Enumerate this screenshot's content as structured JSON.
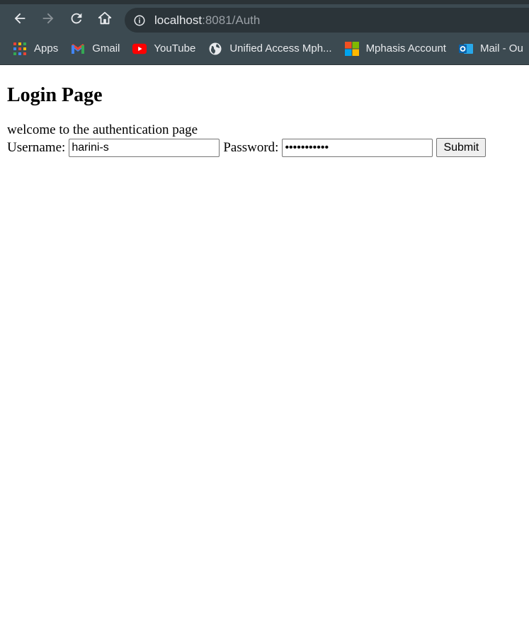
{
  "browser": {
    "url_host": "localhost",
    "url_rest": ":8081/Auth",
    "bookmarks": [
      {
        "label": "Apps",
        "icon": "apps-grid-icon"
      },
      {
        "label": "Gmail",
        "icon": "gmail-icon"
      },
      {
        "label": "YouTube",
        "icon": "youtube-icon"
      },
      {
        "label": "Unified Access Mph...",
        "icon": "globe-icon"
      },
      {
        "label": "Mphasis Account",
        "icon": "microsoft-icon"
      },
      {
        "label": "Mail - Ou",
        "icon": "outlook-icon"
      }
    ]
  },
  "page": {
    "title": "Login Page",
    "welcome": "welcome to the authentication page",
    "username_label": "Username:",
    "username_value": "harini-s",
    "password_label": "Password:",
    "password_value": "•••••••••••",
    "submit_label": "Submit"
  },
  "colors": {
    "toolbar_bg": "#3c4a51",
    "omnibox_bg": "#2b3439",
    "text_light": "#e8eaed"
  }
}
